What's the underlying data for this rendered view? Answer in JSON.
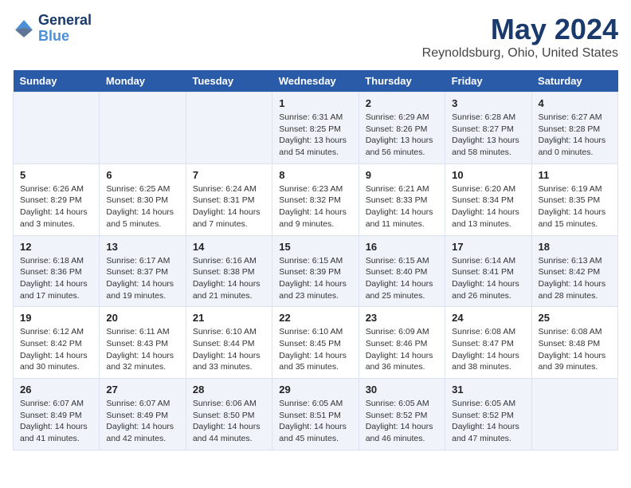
{
  "logo": {
    "line1": "General",
    "line2": "Blue"
  },
  "title": "May 2024",
  "subtitle": "Reynoldsburg, Ohio, United States",
  "days_of_week": [
    "Sunday",
    "Monday",
    "Tuesday",
    "Wednesday",
    "Thursday",
    "Friday",
    "Saturday"
  ],
  "weeks": [
    [
      {
        "day": "",
        "info": ""
      },
      {
        "day": "",
        "info": ""
      },
      {
        "day": "",
        "info": ""
      },
      {
        "day": "1",
        "info": "Sunrise: 6:31 AM\nSunset: 8:25 PM\nDaylight: 13 hours\nand 54 minutes."
      },
      {
        "day": "2",
        "info": "Sunrise: 6:29 AM\nSunset: 8:26 PM\nDaylight: 13 hours\nand 56 minutes."
      },
      {
        "day": "3",
        "info": "Sunrise: 6:28 AM\nSunset: 8:27 PM\nDaylight: 13 hours\nand 58 minutes."
      },
      {
        "day": "4",
        "info": "Sunrise: 6:27 AM\nSunset: 8:28 PM\nDaylight: 14 hours\nand 0 minutes."
      }
    ],
    [
      {
        "day": "5",
        "info": "Sunrise: 6:26 AM\nSunset: 8:29 PM\nDaylight: 14 hours\nand 3 minutes."
      },
      {
        "day": "6",
        "info": "Sunrise: 6:25 AM\nSunset: 8:30 PM\nDaylight: 14 hours\nand 5 minutes."
      },
      {
        "day": "7",
        "info": "Sunrise: 6:24 AM\nSunset: 8:31 PM\nDaylight: 14 hours\nand 7 minutes."
      },
      {
        "day": "8",
        "info": "Sunrise: 6:23 AM\nSunset: 8:32 PM\nDaylight: 14 hours\nand 9 minutes."
      },
      {
        "day": "9",
        "info": "Sunrise: 6:21 AM\nSunset: 8:33 PM\nDaylight: 14 hours\nand 11 minutes."
      },
      {
        "day": "10",
        "info": "Sunrise: 6:20 AM\nSunset: 8:34 PM\nDaylight: 14 hours\nand 13 minutes."
      },
      {
        "day": "11",
        "info": "Sunrise: 6:19 AM\nSunset: 8:35 PM\nDaylight: 14 hours\nand 15 minutes."
      }
    ],
    [
      {
        "day": "12",
        "info": "Sunrise: 6:18 AM\nSunset: 8:36 PM\nDaylight: 14 hours\nand 17 minutes."
      },
      {
        "day": "13",
        "info": "Sunrise: 6:17 AM\nSunset: 8:37 PM\nDaylight: 14 hours\nand 19 minutes."
      },
      {
        "day": "14",
        "info": "Sunrise: 6:16 AM\nSunset: 8:38 PM\nDaylight: 14 hours\nand 21 minutes."
      },
      {
        "day": "15",
        "info": "Sunrise: 6:15 AM\nSunset: 8:39 PM\nDaylight: 14 hours\nand 23 minutes."
      },
      {
        "day": "16",
        "info": "Sunrise: 6:15 AM\nSunset: 8:40 PM\nDaylight: 14 hours\nand 25 minutes."
      },
      {
        "day": "17",
        "info": "Sunrise: 6:14 AM\nSunset: 8:41 PM\nDaylight: 14 hours\nand 26 minutes."
      },
      {
        "day": "18",
        "info": "Sunrise: 6:13 AM\nSunset: 8:42 PM\nDaylight: 14 hours\nand 28 minutes."
      }
    ],
    [
      {
        "day": "19",
        "info": "Sunrise: 6:12 AM\nSunset: 8:42 PM\nDaylight: 14 hours\nand 30 minutes."
      },
      {
        "day": "20",
        "info": "Sunrise: 6:11 AM\nSunset: 8:43 PM\nDaylight: 14 hours\nand 32 minutes."
      },
      {
        "day": "21",
        "info": "Sunrise: 6:10 AM\nSunset: 8:44 PM\nDaylight: 14 hours\nand 33 minutes."
      },
      {
        "day": "22",
        "info": "Sunrise: 6:10 AM\nSunset: 8:45 PM\nDaylight: 14 hours\nand 35 minutes."
      },
      {
        "day": "23",
        "info": "Sunrise: 6:09 AM\nSunset: 8:46 PM\nDaylight: 14 hours\nand 36 minutes."
      },
      {
        "day": "24",
        "info": "Sunrise: 6:08 AM\nSunset: 8:47 PM\nDaylight: 14 hours\nand 38 minutes."
      },
      {
        "day": "25",
        "info": "Sunrise: 6:08 AM\nSunset: 8:48 PM\nDaylight: 14 hours\nand 39 minutes."
      }
    ],
    [
      {
        "day": "26",
        "info": "Sunrise: 6:07 AM\nSunset: 8:49 PM\nDaylight: 14 hours\nand 41 minutes."
      },
      {
        "day": "27",
        "info": "Sunrise: 6:07 AM\nSunset: 8:49 PM\nDaylight: 14 hours\nand 42 minutes."
      },
      {
        "day": "28",
        "info": "Sunrise: 6:06 AM\nSunset: 8:50 PM\nDaylight: 14 hours\nand 44 minutes."
      },
      {
        "day": "29",
        "info": "Sunrise: 6:05 AM\nSunset: 8:51 PM\nDaylight: 14 hours\nand 45 minutes."
      },
      {
        "day": "30",
        "info": "Sunrise: 6:05 AM\nSunset: 8:52 PM\nDaylight: 14 hours\nand 46 minutes."
      },
      {
        "day": "31",
        "info": "Sunrise: 6:05 AM\nSunset: 8:52 PM\nDaylight: 14 hours\nand 47 minutes."
      },
      {
        "day": "",
        "info": ""
      }
    ]
  ],
  "colors": {
    "header_bg": "#2a5ba8",
    "header_text": "#ffffff",
    "odd_row": "#f0f4fa",
    "even_row": "#ffffff",
    "title": "#1a3a6b"
  }
}
